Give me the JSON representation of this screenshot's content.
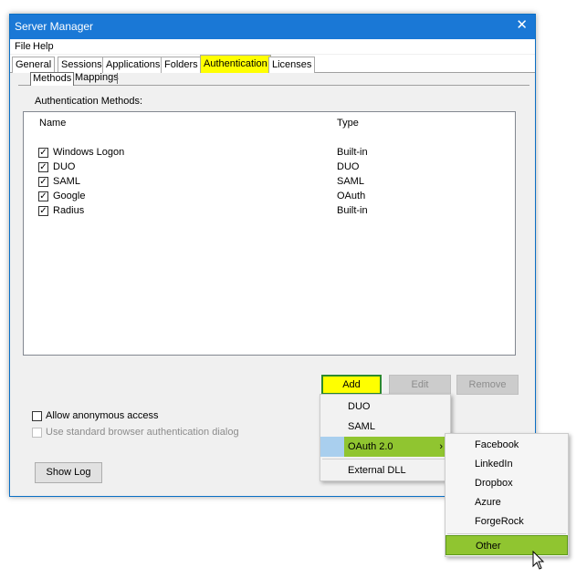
{
  "window": {
    "title": "Server Manager",
    "close_glyph": "✕"
  },
  "menubar": {
    "items": [
      "File",
      "Help"
    ]
  },
  "tabs": [
    {
      "label": "General"
    },
    {
      "label": "Sessions"
    },
    {
      "label": "Applications"
    },
    {
      "label": "Folders"
    },
    {
      "label": "Authentication",
      "active": true
    },
    {
      "label": "Licenses"
    }
  ],
  "inner_tabs": [
    {
      "label": "Methods",
      "active": true
    },
    {
      "label": "Mappings"
    }
  ],
  "auth": {
    "section_label": "Authentication Methods:",
    "columns": {
      "name": "Name",
      "type": "Type"
    },
    "rows": [
      {
        "name": "Windows Logon",
        "type": "Built-in",
        "checked": true
      },
      {
        "name": "DUO",
        "type": "DUO",
        "checked": true
      },
      {
        "name": "SAML",
        "type": "SAML",
        "checked": true
      },
      {
        "name": "Google",
        "type": "OAuth",
        "checked": true
      },
      {
        "name": "Radius",
        "type": "Built-in",
        "checked": true
      }
    ],
    "buttons": {
      "add": "Add",
      "edit": "Edit",
      "remove": "Remove"
    }
  },
  "options": {
    "allow_anonymous": {
      "label": "Allow anonymous access",
      "checked": false
    },
    "browser_dialog": {
      "label": "Use standard browser authentication dialog",
      "checked": false,
      "disabled": true
    }
  },
  "footer": {
    "show_log": "Show Log"
  },
  "add_menu": {
    "items": [
      {
        "label": "DUO"
      },
      {
        "label": "SAML"
      },
      {
        "label": "OAuth 2.0",
        "submenu": true,
        "highlighted": true
      },
      {
        "label": "External DLL"
      }
    ],
    "arrow": "›"
  },
  "oauth_submenu": {
    "items": [
      "Facebook",
      "LinkedIn",
      "Dropbox",
      "Azure",
      "ForgeRock"
    ],
    "other": "Other"
  },
  "colors": {
    "highlight_yellow": "#ffff00",
    "menu_green": "#90c530",
    "title_blue": "#1a78d6"
  }
}
